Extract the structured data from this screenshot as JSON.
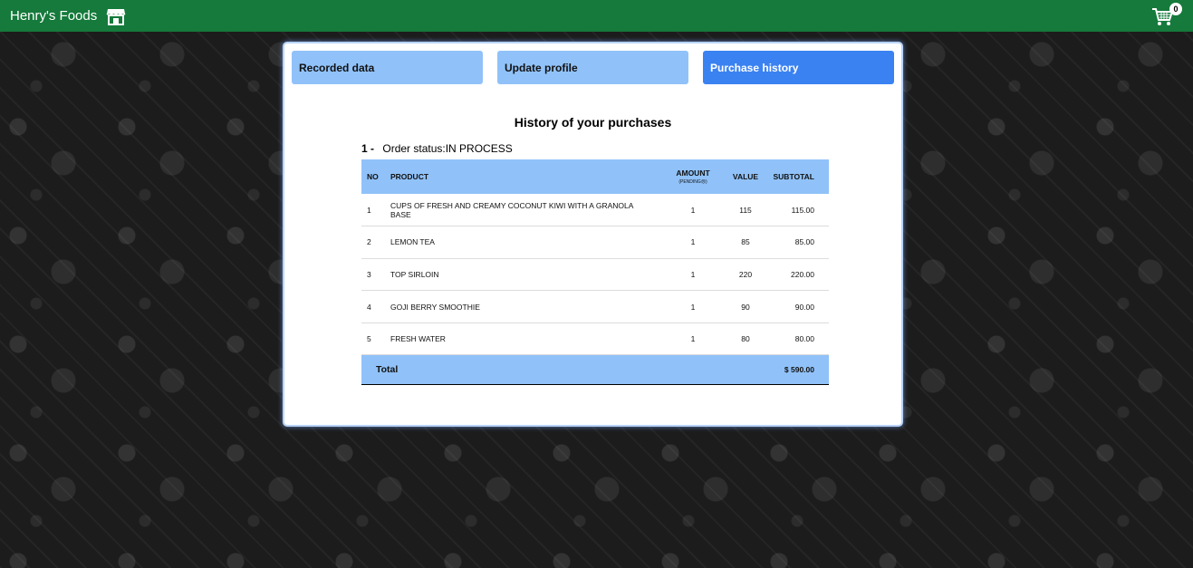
{
  "navbar": {
    "brand": "Henry's Foods",
    "brand_icon": "store-icon",
    "cart_icon": "cart-icon",
    "cart_count": "0",
    "background_color": "#157a3b"
  },
  "tabs": [
    {
      "label": "Recorded data",
      "active": false
    },
    {
      "label": "Update profile",
      "active": false
    },
    {
      "label": "Purchase history",
      "active": true
    }
  ],
  "history": {
    "heading": "History of your purchases",
    "order_number": "1 -",
    "order_status": "Order status:IN PROCESS",
    "columns": {
      "no": "NO",
      "product": "PRODUCT",
      "amount": "AMOUNT",
      "amount_note": "(PENDING😢)",
      "value": "VALUE",
      "subtotal": "SUBTOTAL"
    },
    "rows": [
      {
        "no": "1",
        "product": "CUPS OF FRESH AND CREAMY COCONUT KIWI WITH A GRANOLA BASE",
        "amount": "1",
        "value": "115",
        "subtotal": "115.00"
      },
      {
        "no": "2",
        "product": "LEMON TEA",
        "amount": "1",
        "value": "85",
        "subtotal": "85.00"
      },
      {
        "no": "3",
        "product": "TOP SIRLOIN",
        "amount": "1",
        "value": "220",
        "subtotal": "220.00"
      },
      {
        "no": "4",
        "product": "GOJI BERRY SMOOTHIE",
        "amount": "1",
        "value": "90",
        "subtotal": "90.00"
      },
      {
        "no": "5",
        "product": "FRESH WATER",
        "amount": "1",
        "value": "80",
        "subtotal": "80.00"
      }
    ],
    "total_label": "Total",
    "total_value": "$ 590.00"
  },
  "colors": {
    "tab_inactive": "#90c2f9",
    "tab_active": "#3a82f2",
    "table_header": "#90c2f9"
  }
}
